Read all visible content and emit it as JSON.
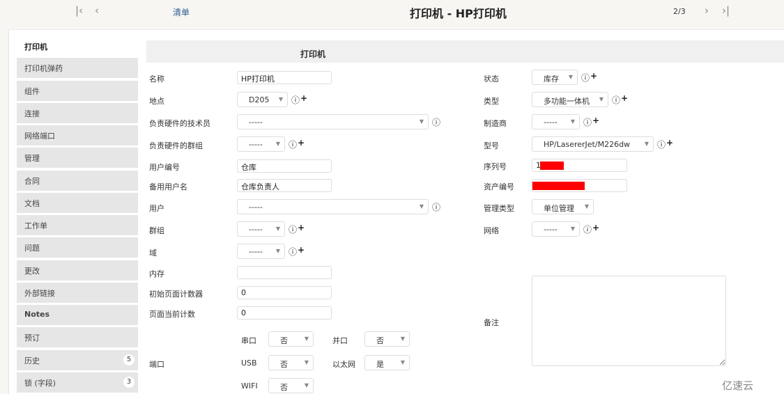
{
  "header": {
    "first_icon": "first-page-icon",
    "prev_icon": "prev-icon",
    "list_link": "清单",
    "title": "打印机 - HP打印机",
    "pager": "2/3",
    "next_icon": "next-icon",
    "last_icon": "last-page-icon"
  },
  "sidebar": {
    "active": "打印机",
    "items": [
      {
        "label": "打印机弹药"
      },
      {
        "label": "组件"
      },
      {
        "label": "连接"
      },
      {
        "label": "网络端口"
      },
      {
        "label": "管理"
      },
      {
        "label": "合同"
      },
      {
        "label": "文档"
      },
      {
        "label": "工作单"
      },
      {
        "label": "问题"
      },
      {
        "label": "更改"
      },
      {
        "label": "外部链接"
      },
      {
        "label": "Notes"
      },
      {
        "label": "预订"
      },
      {
        "label": "历史",
        "count": "5"
      },
      {
        "label": "锁 (字段)",
        "count": "3"
      }
    ]
  },
  "form": {
    "title": "打印机",
    "left": [
      {
        "label": "名称",
        "type": "text",
        "value": "HP打印机"
      },
      {
        "label": "地点",
        "type": "select",
        "value": "D205",
        "info": true,
        "plus": true
      },
      {
        "label": "负责硬件的技术员",
        "type": "select",
        "value": "-----",
        "info": true
      },
      {
        "label": "负责硬件的群组",
        "type": "select",
        "value": "-----",
        "info": true,
        "plus": true
      },
      {
        "label": "用户编号",
        "type": "text",
        "value": "仓库"
      },
      {
        "label": "备用用户名",
        "type": "text",
        "value": "仓库负责人"
      },
      {
        "label": "用户",
        "type": "select",
        "value": "-----",
        "info": true
      },
      {
        "label": "群组",
        "type": "select",
        "value": "-----",
        "info": true,
        "plus": true
      },
      {
        "label": "域",
        "type": "select",
        "value": "-----",
        "info": true,
        "plus": true
      },
      {
        "label": "内存",
        "type": "text",
        "value": ""
      },
      {
        "label": "初始页面计数器",
        "type": "text",
        "value": "0"
      },
      {
        "label": "页面当前计数",
        "type": "text",
        "value": "0"
      }
    ],
    "ports": {
      "label": "端口",
      "items": [
        {
          "label": "串口",
          "value": "否"
        },
        {
          "label": "并口",
          "value": "否"
        },
        {
          "label": "USB",
          "value": "否"
        },
        {
          "label": "以太网",
          "value": "是"
        },
        {
          "label": "WIFI",
          "value": "否"
        }
      ]
    },
    "right": [
      {
        "label": "状态",
        "type": "select",
        "value": "库存",
        "info": true,
        "plus": true
      },
      {
        "label": "类型",
        "type": "select",
        "value": "多功能一体机",
        "info": true,
        "plus": true
      },
      {
        "label": "制造商",
        "type": "select",
        "value": "-----",
        "info": true,
        "plus": true
      },
      {
        "label": "型号",
        "type": "select",
        "value": "HP/LasererJet/M226dw",
        "info": true,
        "plus": true
      },
      {
        "label": "序列号",
        "type": "text",
        "value": "1",
        "redacted": true
      },
      {
        "label": "资产编号",
        "type": "text",
        "value": "",
        "redacted": true
      },
      {
        "label": "管理类型",
        "type": "select",
        "value": "单位管理"
      },
      {
        "label": "网络",
        "type": "select",
        "value": "-----",
        "info": true,
        "plus": true
      }
    ],
    "notes": {
      "label": "备注",
      "value": ""
    }
  },
  "watermark": "亿速云",
  "colors": {
    "redaction": "#ff0000",
    "sidebar_item": "#e6e6e6",
    "header_band": "#f0f0f0"
  }
}
